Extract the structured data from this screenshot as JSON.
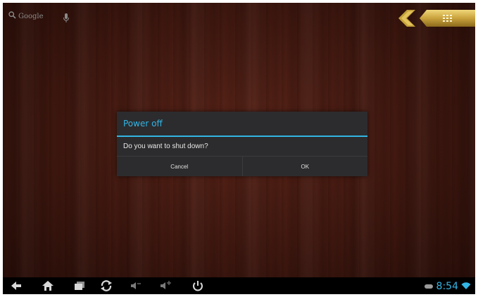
{
  "search": {
    "label": "Google",
    "icon": "search-icon"
  },
  "launcher": {
    "back_icon": "chevron-left-icon",
    "apps_icon": "app-grid-icon"
  },
  "dialog": {
    "title": "Power off",
    "message": "Do you want to shut down?",
    "cancel_label": "Cancel",
    "ok_label": "OK"
  },
  "navbar": {
    "icons": [
      "back-icon",
      "home-icon",
      "recent-apps-icon",
      "rotate-icon",
      "volume-down-icon",
      "volume-up-icon",
      "power-icon"
    ]
  },
  "status": {
    "time": "8:54"
  },
  "colors": {
    "accent": "#33b5e5",
    "dialog_bg": "#2c2c2e",
    "wood": "#3e170f"
  }
}
